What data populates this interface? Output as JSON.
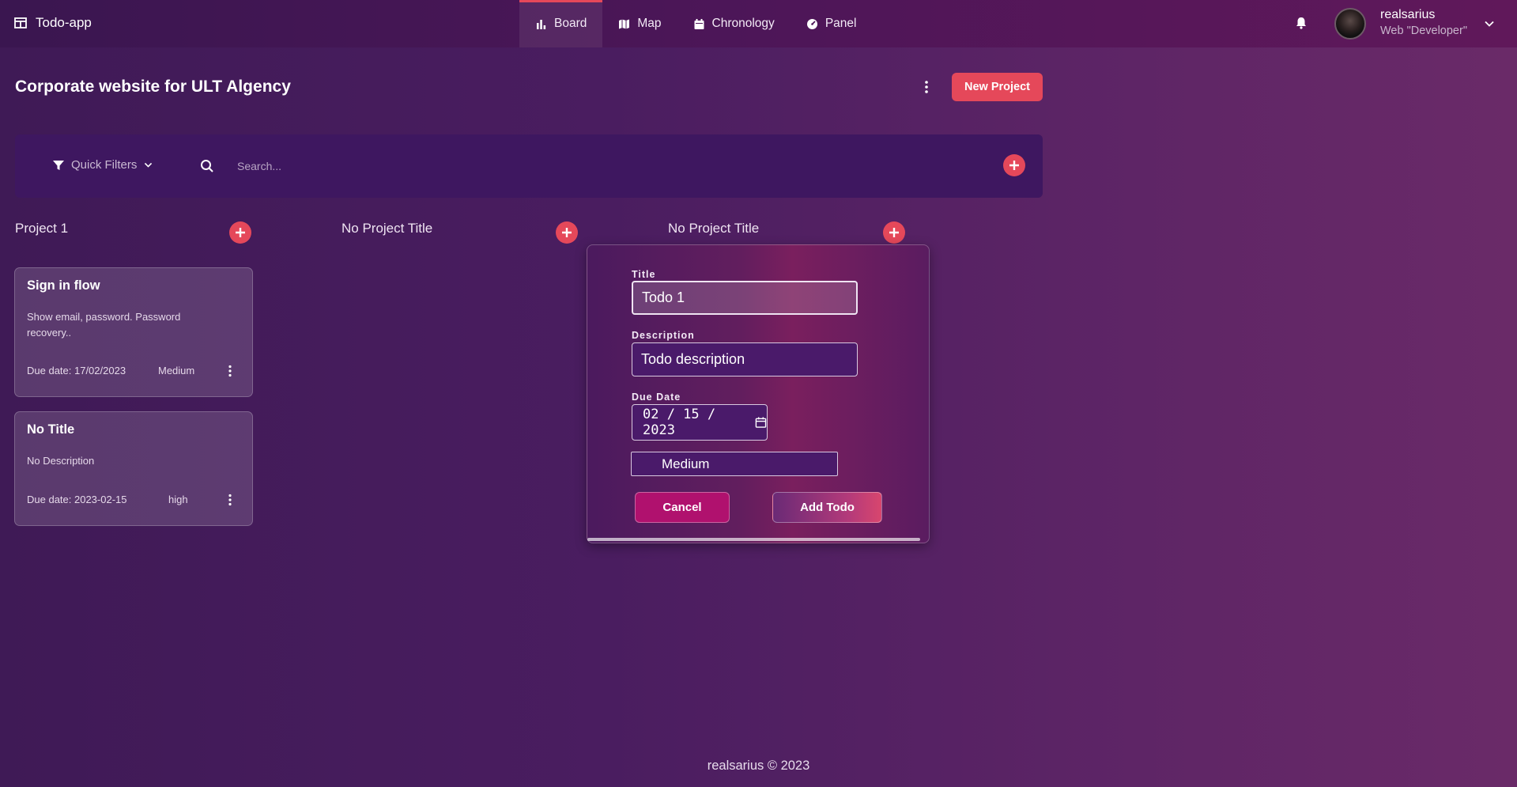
{
  "app": {
    "title": "Todo-app"
  },
  "nav": {
    "items": [
      {
        "label": "Board",
        "icon": "bar-chart-icon",
        "active": true
      },
      {
        "label": "Map",
        "icon": "map-icon"
      },
      {
        "label": "Chronology",
        "icon": "calendar-icon"
      },
      {
        "label": "Panel",
        "icon": "gauge-icon"
      }
    ]
  },
  "user": {
    "name": "realsarius",
    "role": "Web \"Developer\""
  },
  "page": {
    "title": "Corporate website for ULT Algency",
    "new_project_label": "New Project"
  },
  "filter": {
    "quick_filters_label": "Quick Filters",
    "search_placeholder": "Search..."
  },
  "columns": [
    {
      "title": "Project 1"
    },
    {
      "title": "No Project Title"
    },
    {
      "title": "No Project Title"
    }
  ],
  "cards": [
    {
      "title": "Sign in flow",
      "description": "Show email, password. Password recovery..",
      "due": "Due date: 17/02/2023",
      "priority": "Medium"
    },
    {
      "title": "No Title",
      "description": "No Description",
      "due": "Due date: 2023-02-15",
      "priority": "high"
    }
  ],
  "modal": {
    "title_label": "Title",
    "title_value": "Todo 1",
    "description_label": "Description",
    "description_value": "Todo description",
    "due_label": "Due Date",
    "due_value": "02 / 15 / 2023",
    "priority_value": "Medium",
    "cancel_label": "Cancel",
    "add_label": "Add Todo"
  },
  "footer": {
    "text": "realsarius © 2023"
  },
  "colors": {
    "accent": "#e5485a",
    "filterbar": "#3e1760"
  }
}
